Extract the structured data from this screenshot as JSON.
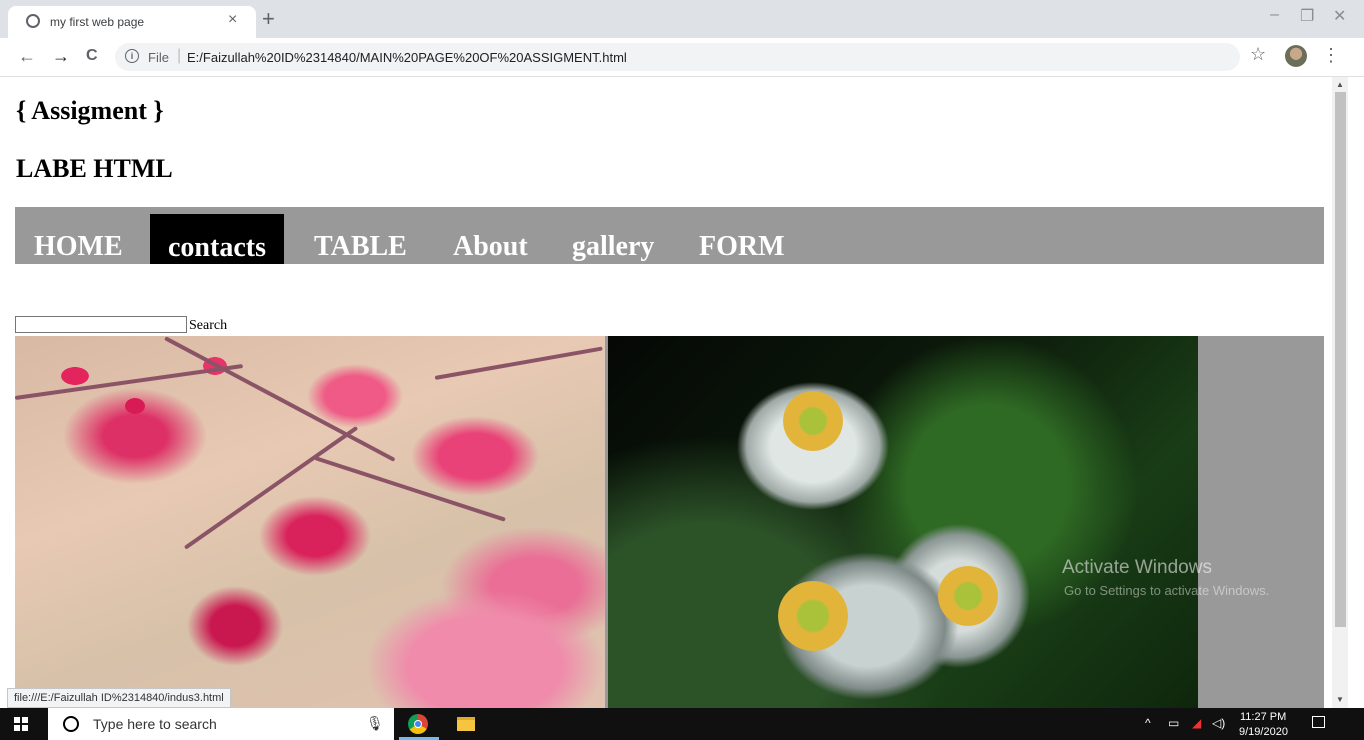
{
  "browser": {
    "tab_title": "my first web page",
    "tab_close": "×",
    "new_tab": "+",
    "window_controls": [
      "–",
      "❐",
      "✕"
    ],
    "nav": {
      "back": "←",
      "forward": "→",
      "reload": "C"
    },
    "scheme_label": "File",
    "url": "E:/Faizullah%20ID%2314840/MAIN%20PAGE%20OF%20ASSIGMENT.html",
    "star": "☆",
    "menu": "⋮"
  },
  "page": {
    "heading1": "{ Assigment }",
    "heading2": "LABE HTML",
    "nav_items": [
      "HOME",
      "contacts",
      "TABLE",
      "About",
      "gallery",
      "FORM"
    ],
    "active_nav": "contacts",
    "search_label": "Search",
    "watermark_title": "Activate Windows",
    "watermark_sub": "Go to Settings to activate Windows.",
    "status_url": "file:///E:/Faizullah ID%2314840/indus3.html",
    "nav_color": "#999999"
  },
  "taskbar": {
    "search_placeholder": "Type here to search",
    "time": "11:27 PM",
    "date": "9/19/2020"
  }
}
